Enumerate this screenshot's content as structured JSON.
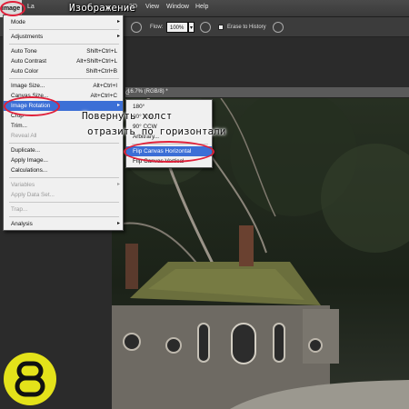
{
  "menubar": {
    "items": [
      "Image",
      "La",
      "3D",
      "View",
      "Window",
      "Help"
    ],
    "caption": "Изображение"
  },
  "options": {
    "flow_label": "Flow:",
    "flow_value": "100%",
    "erase_label": "Erase to History"
  },
  "document": {
    "tab_text": "16.7% (RGB/8) *",
    "menu_suffix": "C"
  },
  "image_menu": {
    "items": [
      {
        "label": "Mode",
        "arrow": "▸"
      },
      {
        "label": "Adjustments",
        "arrow": "▸"
      },
      {
        "label": "Auto Tone",
        "shortcut": "Shift+Ctrl+L"
      },
      {
        "label": "Auto Contrast",
        "shortcut": "Alt+Shift+Ctrl+L"
      },
      {
        "label": "Auto Color",
        "shortcut": "Shift+Ctrl+B"
      },
      {
        "label": "Image Size...",
        "shortcut": "Alt+Ctrl+I"
      },
      {
        "label": "Canvas Size...",
        "shortcut": "Alt+Ctrl+C"
      },
      {
        "label": "Image Rotation",
        "arrow": "▸"
      },
      {
        "label": "Crop"
      },
      {
        "label": "Trim..."
      },
      {
        "label": "Reveal All"
      },
      {
        "label": "Duplicate..."
      },
      {
        "label": "Apply Image..."
      },
      {
        "label": "Calculations..."
      },
      {
        "label": "Variables",
        "arrow": "▸"
      },
      {
        "label": "Apply Data Set..."
      },
      {
        "label": "Trap..."
      },
      {
        "label": "Analysis",
        "arrow": "▸"
      }
    ]
  },
  "rotation_submenu": {
    "items": [
      {
        "label": "180°"
      },
      {
        "label": "90° CW"
      },
      {
        "label": "90° CCW"
      },
      {
        "label": "Arbitrary..."
      },
      {
        "label": "Flip Canvas Horizontal"
      },
      {
        "label": "Flip Canvas Vertical"
      }
    ]
  },
  "captions": {
    "rotate": "Повернуть холст",
    "flip": "отразить по горизонтали"
  },
  "badge": {
    "number": "8",
    "color": "#e4e21a"
  },
  "colors": {
    "highlight": "#3c6fd6",
    "annotation": "#e0203a"
  }
}
